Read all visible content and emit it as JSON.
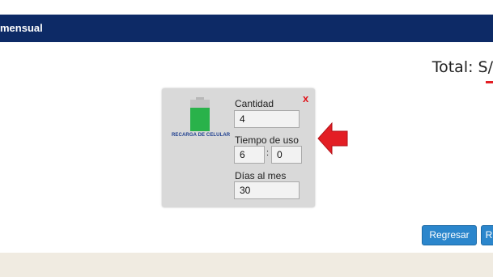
{
  "header": {
    "title": "mensual"
  },
  "summary": {
    "total_label": "Total: S/"
  },
  "popup": {
    "close_label": "x",
    "product_label": "RECARGA DE CELULAR",
    "fields": {
      "cantidad": {
        "label": "Cantidad",
        "value": "4"
      },
      "tiempo": {
        "label": "Tiempo de uso",
        "hours": "6",
        "separator": ":",
        "minutes": "0"
      },
      "dias": {
        "label": "Días al mes",
        "value": "30"
      }
    }
  },
  "buttons": {
    "back": "Regresar",
    "next": "R"
  },
  "colors": {
    "header": "#0d2a66",
    "accent_red": "#e31e24",
    "button": "#2b86cc",
    "battery_green": "#29b24a"
  },
  "icons": {
    "product": "battery-icon",
    "pointer": "red-arrow-left-icon"
  }
}
